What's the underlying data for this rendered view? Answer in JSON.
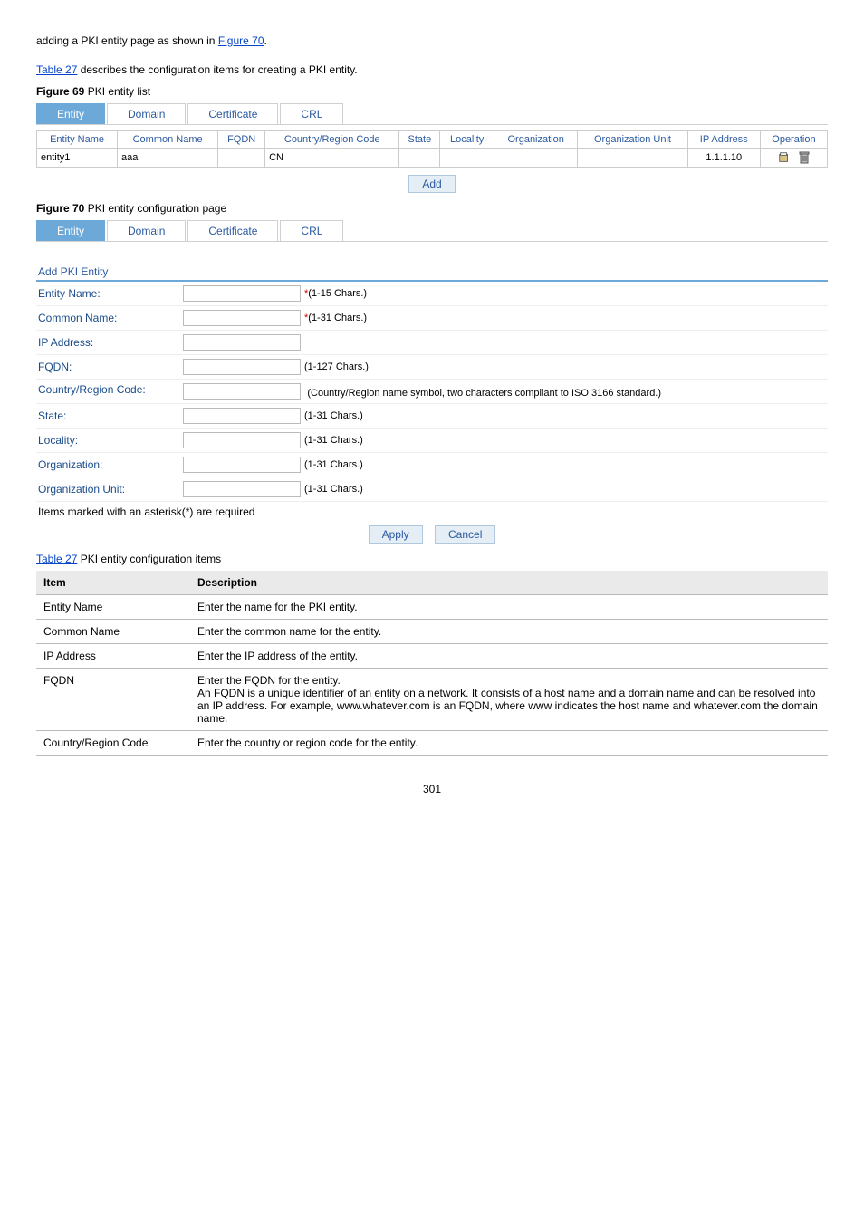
{
  "section1": {
    "intro_prefix": "adding a PKI entity page as shown in ",
    "figure_link": "Figure 70",
    "intro_suffix": ".",
    "table_link": "Table 27",
    "table_sentence_suffix": " describes the configuration items for creating a PKI entity."
  },
  "figure69": {
    "label": "Figure 69",
    "title": "PKI entity list",
    "tabs": [
      "Entity",
      "Domain",
      "Certificate",
      "CRL"
    ],
    "headers": [
      "Entity Name",
      "Common Name",
      "FQDN",
      "Country/Region Code",
      "State",
      "Locality",
      "Organization",
      "Organization Unit",
      "IP Address",
      "Operation"
    ],
    "row": {
      "entity_name": "entity1",
      "common_name": "aaa",
      "fqdn": "",
      "country": "CN",
      "state": "",
      "locality": "",
      "organization": "",
      "org_unit": "",
      "ip": "1.1.1.10"
    },
    "add_button": "Add"
  },
  "figure70": {
    "label": "Figure 70",
    "title": "PKI entity configuration page",
    "tabs": [
      "Entity",
      "Domain",
      "Certificate",
      "CRL"
    ],
    "form_title": "Add PKI Entity",
    "fields": {
      "entity_name": {
        "label": "Entity Name:",
        "hint": "(1-15 Chars.)",
        "required": true
      },
      "common_name": {
        "label": "Common Name:",
        "hint": "(1-31 Chars.)",
        "required": true
      },
      "ip_address": {
        "label": "IP Address:",
        "hint": "",
        "required": false
      },
      "fqdn": {
        "label": "FQDN:",
        "hint": "(1-127 Chars.)",
        "required": false
      },
      "country": {
        "label": "Country/Region Code:",
        "hint": "(Country/Region name symbol, two characters compliant to ISO 3166 standard.)",
        "required": false
      },
      "state": {
        "label": "State:",
        "hint": "(1-31 Chars.)",
        "required": false
      },
      "locality": {
        "label": "Locality:",
        "hint": "(1-31 Chars.)",
        "required": false
      },
      "organization": {
        "label": "Organization:",
        "hint": "(1-31 Chars.)",
        "required": false
      },
      "org_unit": {
        "label": "Organization Unit:",
        "hint": "(1-31 Chars.)",
        "required": false
      }
    },
    "note": "Items marked with an asterisk(*) are required",
    "apply": "Apply",
    "cancel": "Cancel"
  },
  "table27": {
    "label": "Table 27",
    "title": "PKI entity configuration items",
    "headers": [
      "Item",
      "Description"
    ],
    "rows": [
      {
        "item": "Entity Name",
        "desc": "Enter the name for the PKI entity."
      },
      {
        "item": "Common Name",
        "desc": "Enter the common name for the entity."
      },
      {
        "item": "IP Address",
        "desc": "Enter the IP address of the entity."
      },
      {
        "item": "FQDN",
        "desc": "Enter the FQDN for the entity.\nAn FQDN is a unique identifier of an entity on a network. It consists of a host name and a domain name and can be resolved into an IP address. For example, www.whatever.com is an FQDN, where www indicates the host name and whatever.com the domain name."
      },
      {
        "item": "Country/Region Code",
        "desc": "Enter the country or region code for the entity."
      }
    ]
  },
  "footer": {
    "page": "301"
  }
}
